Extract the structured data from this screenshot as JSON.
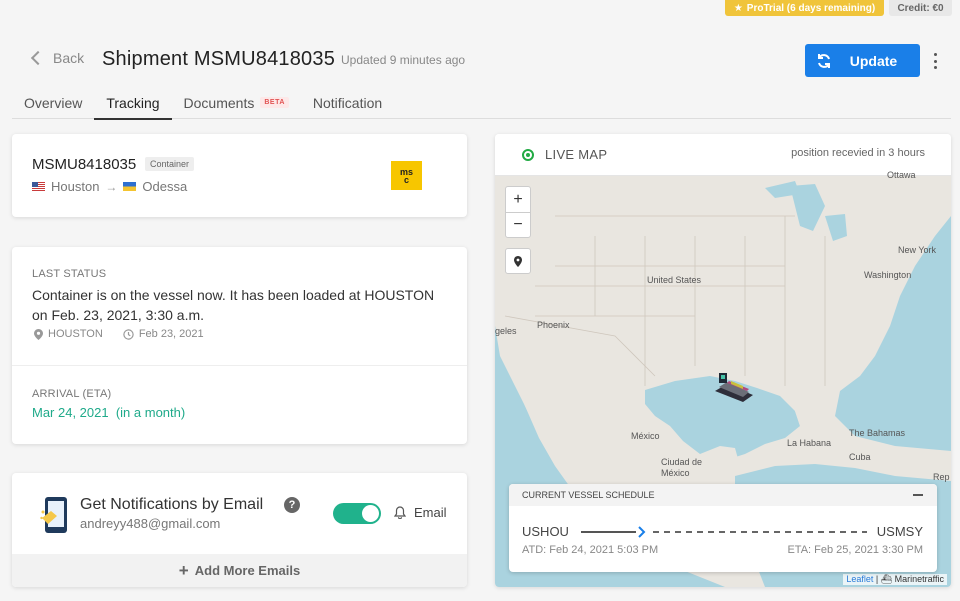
{
  "topbar": {
    "pro_trial": "ProTrial (6 days remaining)",
    "credit": "Credit: €0"
  },
  "header": {
    "back_label": "Back",
    "title": "Shipment MSMU8418035",
    "updated": "Updated 9 minutes ago",
    "update_label": "Update"
  },
  "tabs": [
    {
      "label": "Overview"
    },
    {
      "label": "Tracking",
      "active": true
    },
    {
      "label": "Documents",
      "badge": "BETA"
    },
    {
      "label": "Notification"
    }
  ],
  "container": {
    "number": "MSMU8418035",
    "type": "Container",
    "origin": "Houston",
    "destination": "Odessa",
    "carrier_logo": "MSC"
  },
  "status": {
    "last_status_label": "LAST STATUS",
    "text": "Container is on the vessel now. It has been loaded at HOUSTON on Feb. 23, 2021, 3:30 a.m.",
    "location": "HOUSTON",
    "date": "Feb 23, 2021",
    "arrival_label": "ARRIVAL (ETA)",
    "arrival_date": "Mar 24, 2021",
    "arrival_relative": "(in a month)"
  },
  "notifications": {
    "title": "Get Notifications by Email",
    "email": "andreyy488@gmail.com",
    "toggle_on": true,
    "channel_label": "Email",
    "add_more": "Add More Emails"
  },
  "map": {
    "title": "LIVE MAP",
    "position_note": "position recevied in 3 hours",
    "labels": {
      "ottawa": "Ottawa",
      "newyork": "New York",
      "washington": "Washington",
      "us": "United States",
      "phoenix": "Phoenix",
      "angeles": "geles",
      "mexico": "México",
      "cdmx": "Ciudad de México",
      "habana": "La Habana",
      "bahamas": "The Bahamas",
      "cuba": "Cuba",
      "rep": "Rep"
    },
    "attribution_link": "Leaflet",
    "attribution_source": "Marinetraffic",
    "schedule": {
      "title": "CURRENT VESSEL SCHEDULE",
      "from_port": "USHOU",
      "to_port": "USMSY",
      "atd": "ATD: Feb 24, 2021 5:03 PM",
      "eta": "ETA: Feb 25, 2021 3:30 PM"
    }
  },
  "colors": {
    "primary": "#1a7fe8",
    "accent_green": "#20b28c",
    "pro_badge": "#f0c43a",
    "live": "#22aa44"
  }
}
